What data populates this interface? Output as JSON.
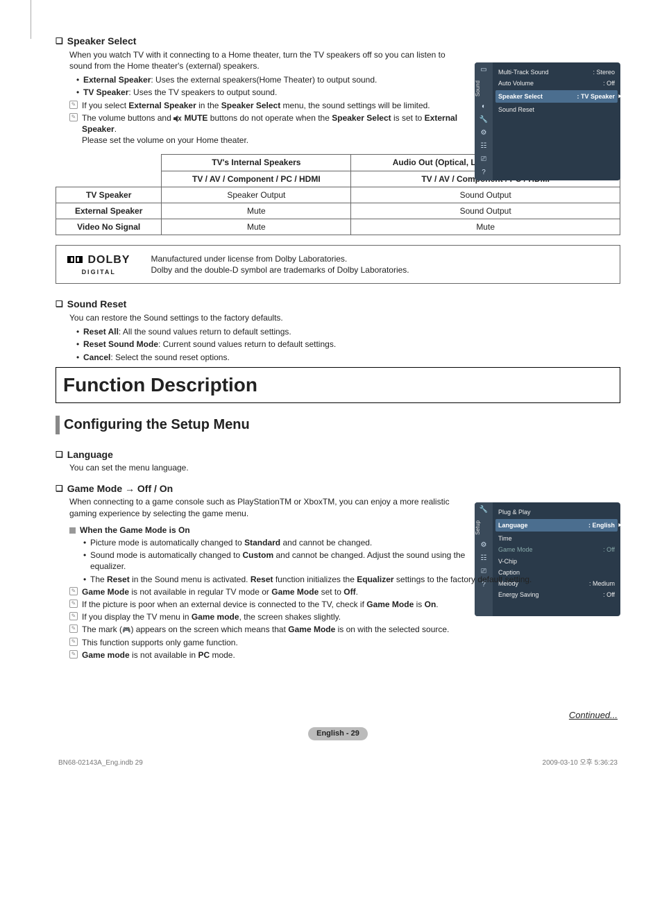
{
  "speaker_select": {
    "title": "Speaker Select",
    "intro": "When you watch TV with it connecting to a Home theater, turn the TV speakers off so you can listen to sound from the Home theater's (external) speakers.",
    "bullets": {
      "ext_label": "External Speaker",
      "ext_text": ": Uses the external speakers(Home Theater) to output sound.",
      "tv_label": "TV Speaker",
      "tv_text": ": Uses the TV speakers to output sound."
    },
    "note1_a": "If you select ",
    "note1_b": "External Speaker",
    "note1_c": " in the ",
    "note1_d": "Speaker Select",
    "note1_e": " menu, the sound settings will be limited.",
    "note2_a": "The volume buttons and ",
    "note2_b": "MUTE",
    "note2_c": " buttons do not operate when the ",
    "note2_d": "Speaker Select",
    "note2_e": " is set to ",
    "note2_f": "External Speaker",
    "note2_g": ".",
    "note2_h": "Please set the volume on your Home theater."
  },
  "osd_sound": {
    "tab": "Sound",
    "rows": {
      "mts_label": "Multi-Track Sound",
      "mts_val": ": Stereo",
      "av_label": "Auto Volume",
      "av_val": ": Off",
      "ss_label": "Speaker Select",
      "ss_val": ": TV Speaker",
      "sr_label": "Sound Reset"
    }
  },
  "table": {
    "h1": "TV's Internal Speakers",
    "h2": "Audio Out (Optical, L / R Out) to Sound System",
    "sub": "TV / AV / Component / PC / HDMI",
    "r1": "TV Speaker",
    "r1a": "Speaker Output",
    "r1b": "Sound Output",
    "r2": "External Speaker",
    "r2a": "Mute",
    "r2b": "Sound Output",
    "r3": "Video No Signal",
    "r3a": "Mute",
    "r3b": "Mute"
  },
  "dolby": {
    "brand": "DOLBY",
    "sub": "DIGITAL",
    "line1": "Manufactured under license from Dolby Laboratories.",
    "line2": "Dolby and the double-D symbol are trademarks of Dolby Laboratories."
  },
  "sound_reset": {
    "title": "Sound Reset",
    "intro": "You can restore the Sound settings to the factory defaults.",
    "b1l": "Reset All",
    "b1t": ": All the sound values return to default settings.",
    "b2l": "Reset Sound Mode",
    "b2t": ": Current sound values return to default settings.",
    "b3l": "Cancel",
    "b3t": ": Select the sound reset options."
  },
  "h1": "Function Description",
  "h2": "Configuring the Setup Menu",
  "language": {
    "title": "Language",
    "intro": "You can set the menu language."
  },
  "game_mode": {
    "title": "Game Mode → Off / On",
    "intro": "When connecting to a game console such as PlayStationTM or XboxTM, you can enjoy a more realistic gaming experience by selecting the game menu.",
    "sub": "When the Game Mode is On",
    "b1a": "Picture mode is automatically changed to ",
    "b1b": "Standard",
    "b1c": " and cannot be changed.",
    "b2a": "Sound mode is automatically changed to ",
    "b2b": "Custom",
    "b2c": " and cannot be changed. Adjust the sound using the equalizer.",
    "b3a": "The ",
    "b3b": "Reset",
    "b3c": " in the Sound menu is activated. ",
    "b3d": "Reset",
    "b3e": " function initializes the ",
    "b3f": "Equalizer",
    "b3g": " settings to the factory default setting.",
    "n1a": "Game Mode",
    "n1b": " is not available in regular TV mode or ",
    "n1c": "Game Mode",
    "n1d": " set to ",
    "n1e": "Off",
    "n1f": ".",
    "n2a": "If the picture is poor when an external device is connected to the TV, check if ",
    "n2b": "Game Mode",
    "n2c": " is ",
    "n2d": "On",
    "n2e": ".",
    "n3a": "If you display the TV menu in ",
    "n3b": "Game mode",
    "n3c": ", the screen shakes slightly.",
    "n4a": "The mark (",
    "n4b": ") appears on the screen which means that ",
    "n4c": "Game Mode",
    "n4d": " is on with the selected source.",
    "n5": "This function supports only game function.",
    "n6a": "Game mode",
    "n6b": " is not available in ",
    "n6c": "PC",
    "n6d": " mode."
  },
  "osd_setup": {
    "tab": "Setup",
    "rows": {
      "pp": "Plug & Play",
      "lang_l": "Language",
      "lang_v": ": English",
      "time": "Time",
      "gm_l": "Game Mode",
      "gm_v": ": Off",
      "vchip": "V-Chip",
      "caption": "Caption",
      "mel_l": "Melody",
      "mel_v": ": Medium",
      "es_l": "Energy Saving",
      "es_v": ": Off"
    }
  },
  "continued": "Continued...",
  "page_num": "English - 29",
  "footer": {
    "left": "BN68-02143A_Eng.indb   29",
    "right": "2009-03-10   오후 5:36:23"
  }
}
